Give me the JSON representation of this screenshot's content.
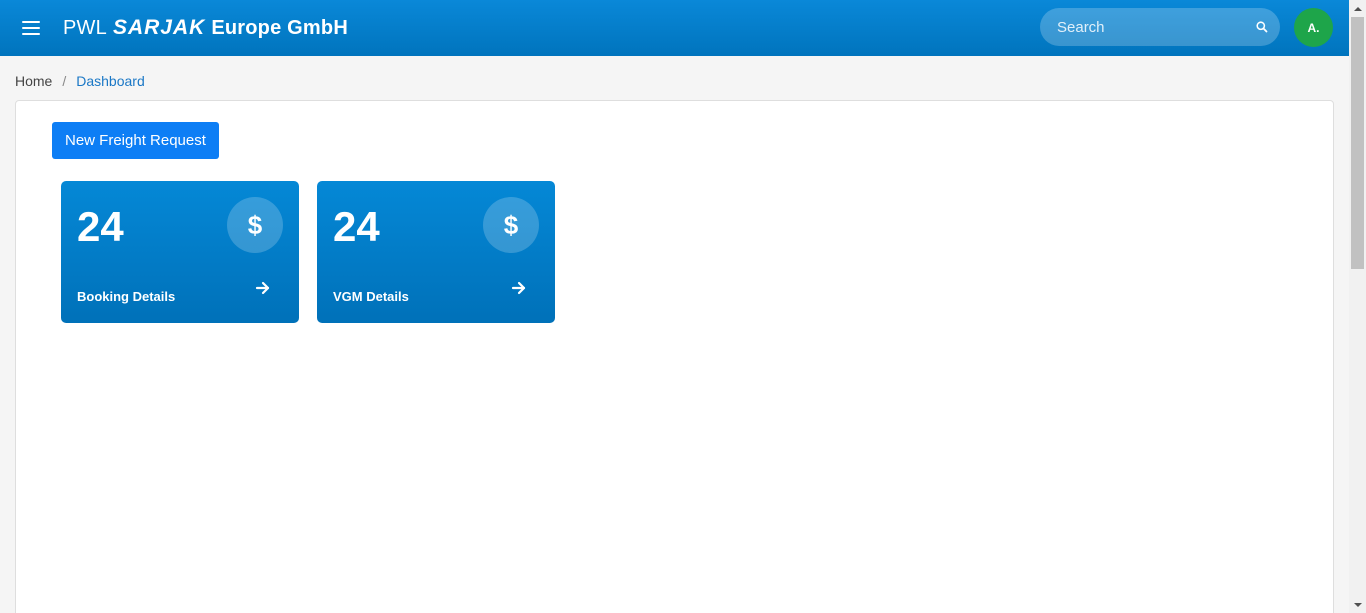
{
  "header": {
    "brand_prefix": "PWL",
    "brand_logo": "SARJAK",
    "brand_suffix": "Europe GmbH",
    "search_placeholder": "Search",
    "avatar_initials": "A."
  },
  "breadcrumb": {
    "home": "Home",
    "separator": "/",
    "current": "Dashboard"
  },
  "main": {
    "new_request_label": "New Freight Request",
    "cards": [
      {
        "count": "24",
        "icon": "$",
        "label": "Booking Details"
      },
      {
        "count": "24",
        "icon": "$",
        "label": "VGM Details"
      }
    ]
  },
  "colors": {
    "header": "#0a88d8",
    "button": "#0d7ef5",
    "card": "#0588d6",
    "avatar": "#1ea54a"
  }
}
